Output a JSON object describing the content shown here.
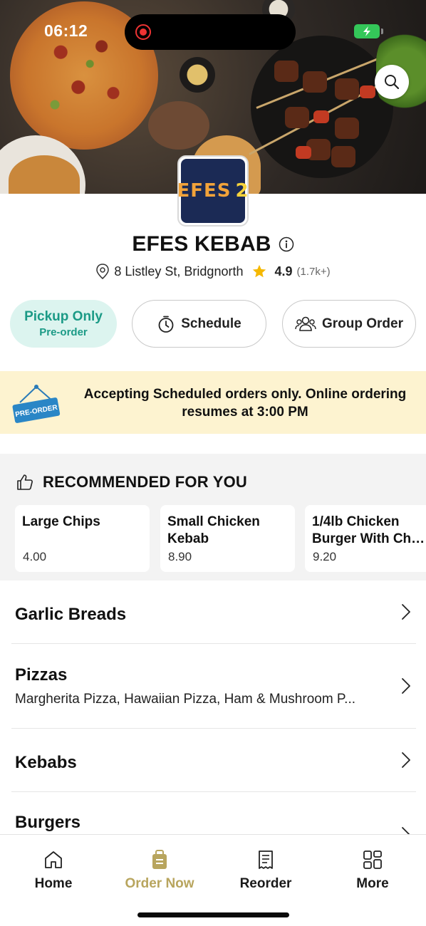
{
  "status_bar": {
    "time": "06:12"
  },
  "restaurant": {
    "logo_text_main": "EFES",
    "logo_text_num": "2",
    "name": "EFES KEBAB",
    "address": "8 Listley St, Bridgnorth",
    "rating": "4.9",
    "rating_count": "(1.7k+)"
  },
  "actions": {
    "pickup_label": "Pickup Only",
    "pickup_sub": "Pre-order",
    "schedule_label": "Schedule",
    "group_order_label": "Group Order"
  },
  "banner": {
    "sign_text": "PRE-ORDER",
    "message": "Accepting Scheduled orders only. Online ordering resumes at 3:00 PM"
  },
  "recommended": {
    "title": "RECOMMENDED FOR YOU",
    "items": [
      {
        "name": "Large Chips",
        "price": "4.00"
      },
      {
        "name": "Small Chicken Kebab",
        "price": "8.90"
      },
      {
        "name_line1": "1/4lb Chicken",
        "name_line2": "Burger With Chi...",
        "price": "9.20"
      }
    ]
  },
  "categories": [
    {
      "title": "Garlic Breads",
      "subtitle": ""
    },
    {
      "title": "Pizzas",
      "subtitle": "Margherita Pizza, Hawaiian Pizza, Ham & Mushroom P..."
    },
    {
      "title": "Kebabs",
      "subtitle": ""
    },
    {
      "title": "Burgers",
      "subtitle": ""
    }
  ],
  "tabs": [
    {
      "label": "Home",
      "icon": "home-icon"
    },
    {
      "label": "Order Now",
      "icon": "order-bag-icon",
      "active": true
    },
    {
      "label": "Reorder",
      "icon": "receipt-icon"
    },
    {
      "label": "More",
      "icon": "grid-icon"
    }
  ],
  "colors": {
    "accent_teal": "#1b9a86",
    "pickup_bg": "#dcf4ef",
    "banner_bg": "#fdf3d0",
    "active_tab": "#b8a55e",
    "star": "#f5b800"
  }
}
